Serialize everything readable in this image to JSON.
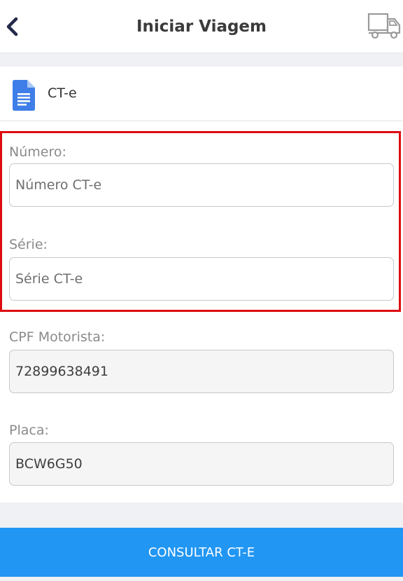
{
  "header": {
    "title": "Iniciar Viagem",
    "back_icon": "chevron-left-icon",
    "truck_icon": "truck-icon"
  },
  "card": {
    "title": "CT-e",
    "icon": "document-icon"
  },
  "form": {
    "numero": {
      "label": "Número:",
      "placeholder": "Número CT-e",
      "value": ""
    },
    "serie": {
      "label": "Série:",
      "placeholder": "Série CT-e",
      "value": ""
    },
    "cpf": {
      "label": "CPF Motorista:",
      "value": "72899638491"
    },
    "placa": {
      "label": "Placa:",
      "value": "BCW6G50"
    }
  },
  "action": {
    "label": "CONSULTAR CT-E"
  },
  "colors": {
    "primary": "#2196f3",
    "highlight": "#dd0b12",
    "doc_icon": "#3f7ee8"
  }
}
